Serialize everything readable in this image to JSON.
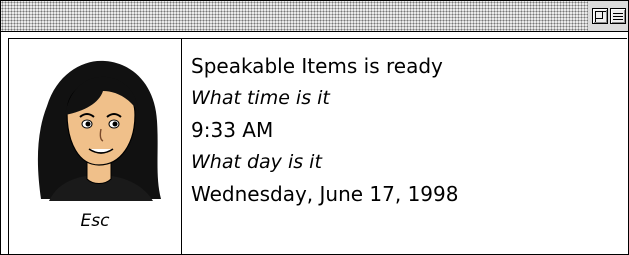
{
  "window": {
    "title": ""
  },
  "character": {
    "icon": "woman-face-icon",
    "esc_label": "Esc"
  },
  "transcript": [
    {
      "speaker": "computer",
      "text": "Speakable Items is ready"
    },
    {
      "speaker": "user",
      "text": "What time is it"
    },
    {
      "speaker": "computer",
      "text": "9:33 AM"
    },
    {
      "speaker": "user",
      "text": "What day is it"
    },
    {
      "speaker": "computer",
      "text": "Wednesday, June 17, 1998"
    }
  ],
  "colors": {
    "hair": "#111111",
    "skin": "#f0c08a",
    "shirt": "#1a1a1a"
  }
}
